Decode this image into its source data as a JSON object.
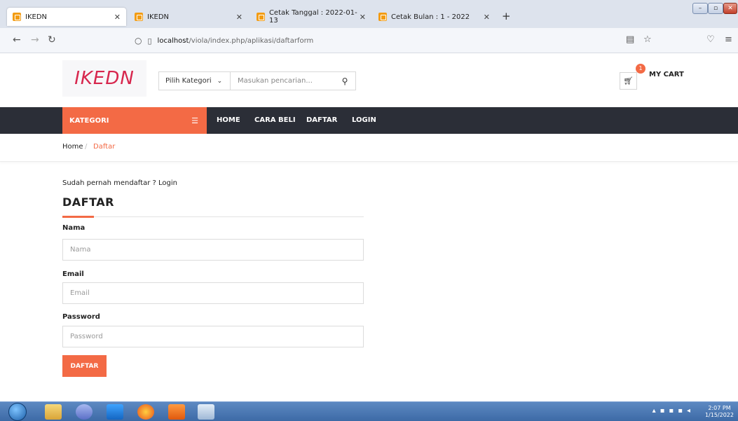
{
  "browser": {
    "tabs": [
      {
        "title": "IKEDN"
      },
      {
        "title": "IKEDN"
      },
      {
        "title": "Cetak Tanggal : 2022-01-13"
      },
      {
        "title": "Cetak Bulan : 1 - 2022"
      }
    ],
    "url_host": "localhost",
    "url_path": "/viola/index.php/aplikasi/daftarform"
  },
  "header": {
    "logo": "IKEDN",
    "category_label": "Pilih Kategori",
    "search_placeholder": "Masukan pencarian...",
    "cart_count": "1",
    "cart_label": "MY CART"
  },
  "nav": {
    "kategori": "KATEGORI",
    "links": [
      "HOME",
      "CARA BELI",
      "DAFTAR",
      "LOGIN"
    ]
  },
  "breadcrumb": {
    "home": "Home",
    "separator": "/",
    "current": "Daftar"
  },
  "form": {
    "already_text": "Sudah pernah mendaftar ? Login",
    "title": "DAFTAR",
    "fields": [
      {
        "label": "Nama",
        "placeholder": "Nama"
      },
      {
        "label": "Email",
        "placeholder": "Email"
      },
      {
        "label": "Password",
        "placeholder": "Password"
      }
    ],
    "submit_label": "DAFTAR"
  },
  "taskbar": {
    "time": "2:07 PM",
    "date": "1/15/2022"
  },
  "colors": {
    "accent": "#f36a45",
    "nav_bg": "#2b2e37",
    "logo": "#d7264d"
  }
}
